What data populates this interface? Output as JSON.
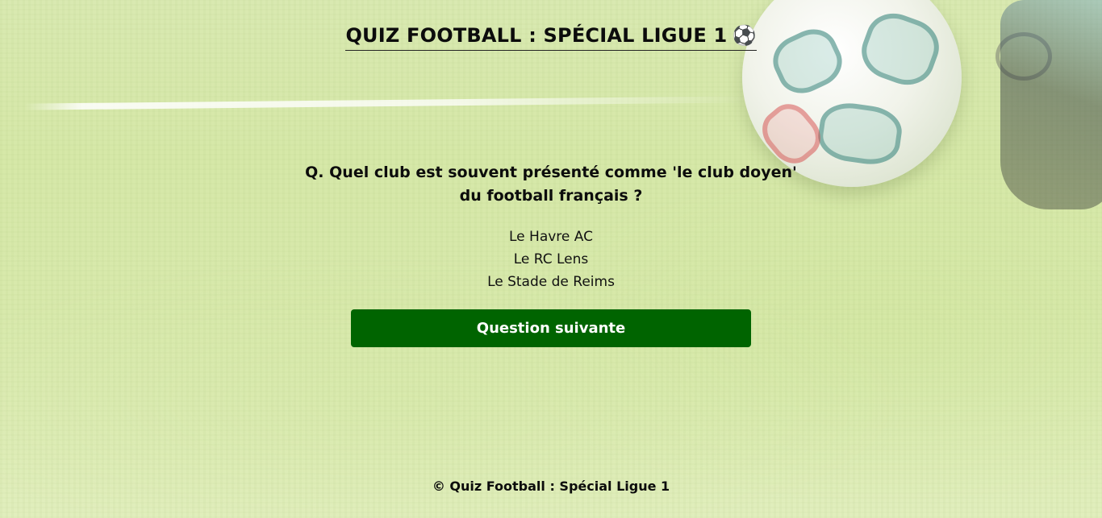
{
  "header": {
    "title": "QUIZ FOOTBALL : SPÉCIAL LIGUE 1",
    "title_icon": "⚽",
    "title_icon_name": "soccer-ball-icon"
  },
  "quiz": {
    "question": "Q. Quel club est souvent présenté comme 'le club doyen' du football français ?",
    "answers": [
      "Le Havre AC",
      "Le RC Lens",
      "Le Stade de Reims"
    ],
    "next_button_label": "Question suivante"
  },
  "footer": {
    "text": "© Quiz Football : Spécial Ligue 1"
  },
  "colors": {
    "button_bg": "#006400",
    "button_text": "#ffffff",
    "text": "#0c0c0c",
    "background": "#d7e8ac"
  }
}
